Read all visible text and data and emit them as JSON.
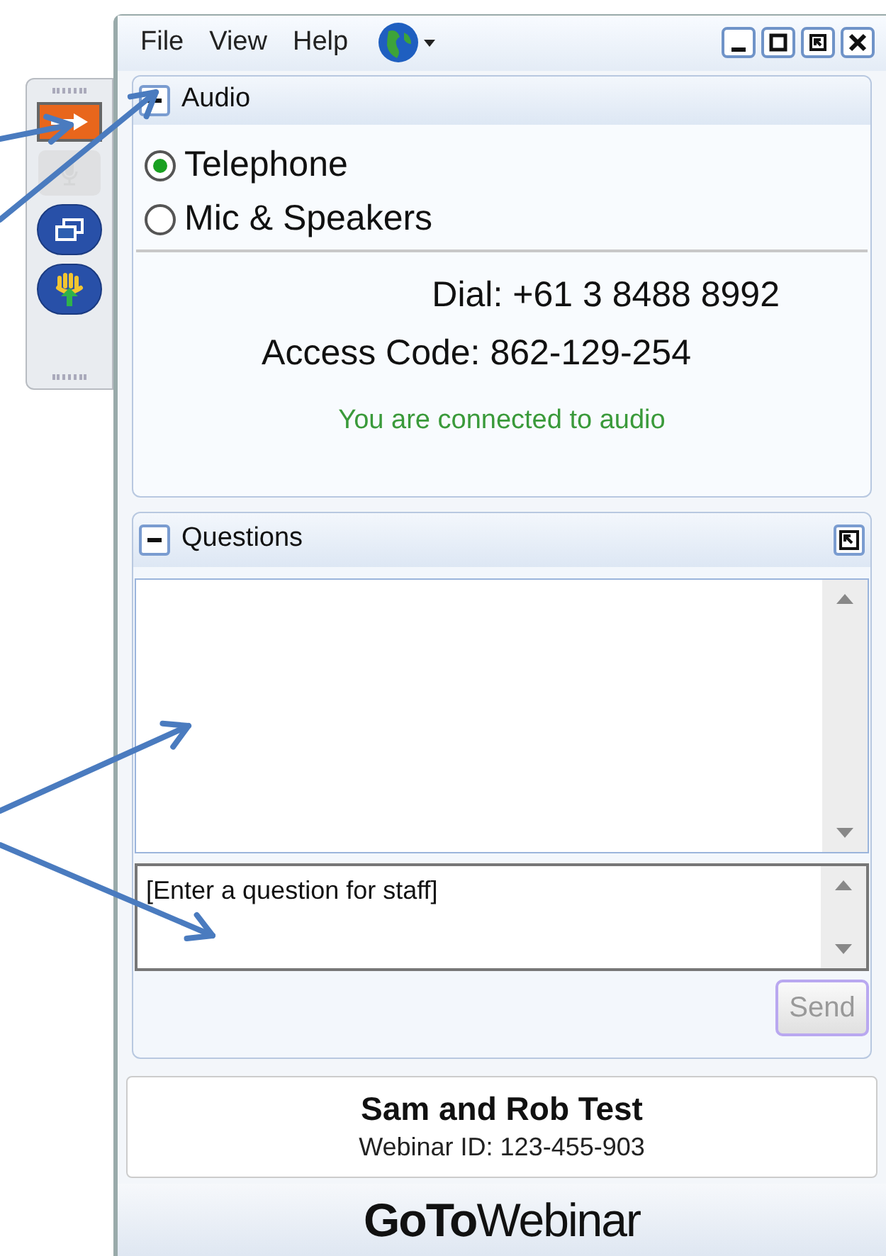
{
  "side_toolbar": [
    {
      "kind": "arrow",
      "disabled": false
    },
    {
      "kind": "mic",
      "disabled": true
    },
    {
      "kind": "windows",
      "disabled": false
    },
    {
      "kind": "hand",
      "disabled": false
    }
  ],
  "menu": [
    "File",
    "View",
    "Help"
  ],
  "audio": {
    "title": "Audio",
    "expanded": true,
    "options": [
      {
        "label": "Telephone",
        "selected": true
      },
      {
        "label": "Mic & Speakers",
        "selected": false
      }
    ],
    "dial": "Dial: +61 3 8488 8992",
    "access_code": "Access Code: 862-129-254",
    "status": "You are connected to audio"
  },
  "questions": {
    "title": "Questions",
    "expanded": true,
    "input": {
      "placeholder": "[Enter a question for staff]"
    },
    "send": {
      "label": "Send",
      "disabled": true
    }
  },
  "webinar": {
    "title": "Sam and Rob Test",
    "id": "Webinar ID: 123-455-903"
  },
  "logo": "**GoTo**Webinar"
}
